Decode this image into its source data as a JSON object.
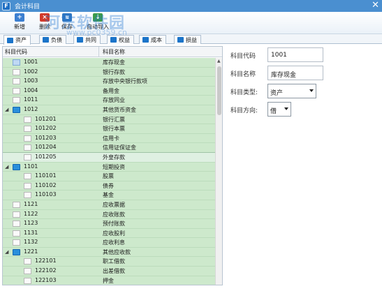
{
  "window": {
    "title": "会计科目",
    "app_icon": "F"
  },
  "toolbar": {
    "buttons": [
      {
        "label": "新增",
        "icon": "new-icon",
        "color": "#3c7fd0"
      },
      {
        "label": "删除",
        "icon": "delete-icon",
        "color": "#d23a2a"
      },
      {
        "label": "保存",
        "icon": "save-icon",
        "color": "#2e76c2"
      },
      {
        "label": "自动导入",
        "icon": "import-icon",
        "color": "#3b9a4b"
      }
    ]
  },
  "watermark": {
    "text": "河东软件园",
    "url": "www.pc0359.cn"
  },
  "tabs": [
    {
      "label": "资产"
    },
    {
      "label": "负债"
    },
    {
      "label": "共同"
    },
    {
      "label": "权益"
    },
    {
      "label": "成本"
    },
    {
      "label": "损益"
    }
  ],
  "tree": {
    "header_code": "科目代码",
    "header_name": "科目名称",
    "rows": [
      {
        "code": "1001",
        "name": "库存现金",
        "level": 0,
        "folder": false
      },
      {
        "code": "1002",
        "name": "银行存款",
        "level": 0,
        "folder": false
      },
      {
        "code": "1003",
        "name": "存放中央银行款项",
        "level": 0,
        "folder": false
      },
      {
        "code": "1004",
        "name": "备用金",
        "level": 0,
        "folder": false
      },
      {
        "code": "1011",
        "name": "存放同业",
        "level": 0,
        "folder": false
      },
      {
        "code": "1012",
        "name": "其他货币资金",
        "level": 0,
        "folder": true
      },
      {
        "code": "101201",
        "name": "银行汇票",
        "level": 1,
        "folder": false
      },
      {
        "code": "101202",
        "name": "银行本票",
        "level": 1,
        "folder": false
      },
      {
        "code": "101203",
        "name": "信用卡",
        "level": 1,
        "folder": false
      },
      {
        "code": "101204",
        "name": "信用证保证金",
        "level": 1,
        "folder": false
      },
      {
        "code": "101205",
        "name": "外皇存款",
        "level": 1,
        "folder": false
      },
      {
        "code": "1101",
        "name": "短期投资",
        "level": 0,
        "folder": true
      },
      {
        "code": "110101",
        "name": "股票",
        "level": 1,
        "folder": false
      },
      {
        "code": "110102",
        "name": "债券",
        "level": 1,
        "folder": false
      },
      {
        "code": "110103",
        "name": "基金",
        "level": 1,
        "folder": false
      },
      {
        "code": "1121",
        "name": "应收票据",
        "level": 0,
        "folder": false
      },
      {
        "code": "1122",
        "name": "应收账款",
        "level": 0,
        "folder": false
      },
      {
        "code": "1123",
        "name": "预付账款",
        "level": 0,
        "folder": false
      },
      {
        "code": "1131",
        "name": "应收股利",
        "level": 0,
        "folder": false
      },
      {
        "code": "1132",
        "name": "应收利息",
        "level": 0,
        "folder": false
      },
      {
        "code": "1221",
        "name": "其他应收款",
        "level": 0,
        "folder": true
      },
      {
        "code": "122101",
        "name": "职工借款",
        "level": 1,
        "folder": false
      },
      {
        "code": "122102",
        "name": "出差借款",
        "level": 1,
        "folder": false
      },
      {
        "code": "122103",
        "name": "押金",
        "level": 1,
        "folder": false
      }
    ]
  },
  "form": {
    "code_label": "科目代码",
    "code_value": "1001",
    "name_label": "科目名称",
    "name_value": "库存现金",
    "type_label": "科目类型:",
    "type_value": "资产",
    "direction_label": "科目方向:",
    "direction_value": "借"
  }
}
